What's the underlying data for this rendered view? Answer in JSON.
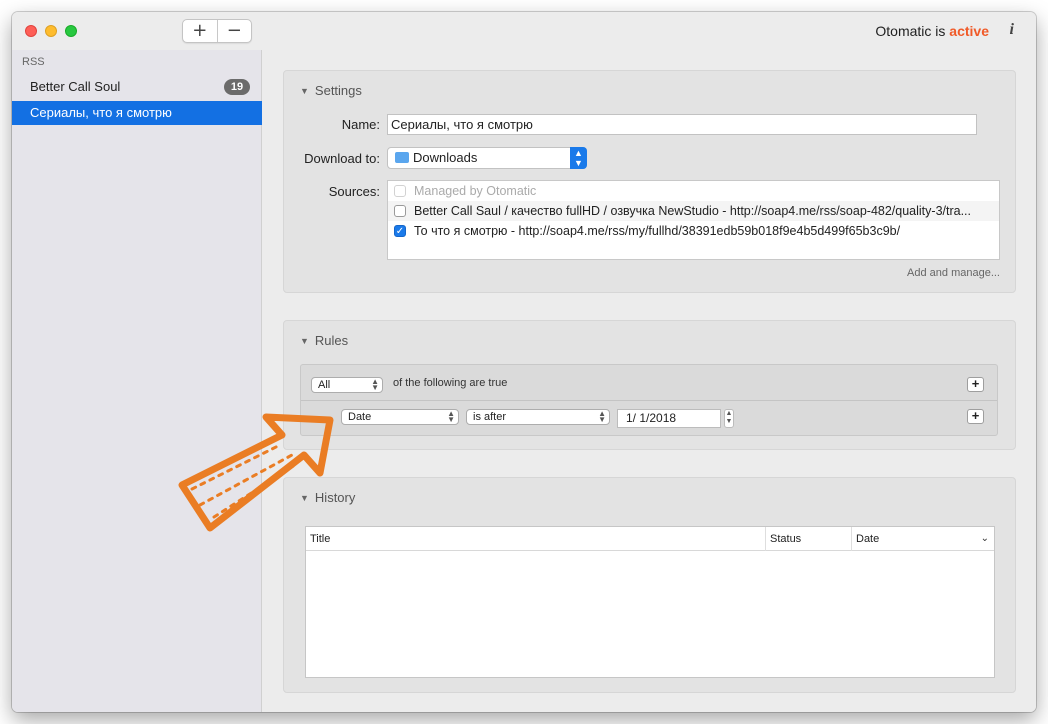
{
  "window": {
    "status_prefix": "Otomatic is",
    "status_value": "active",
    "info_icon": "i",
    "toolbar": {
      "add_label": "+",
      "remove_label": "−"
    }
  },
  "sidebar": {
    "header": "RSS",
    "items": [
      {
        "label": "Better Call Soul",
        "badge": "19"
      },
      {
        "label": "Сериалы, что я смотрю"
      }
    ]
  },
  "settings": {
    "title": "Settings",
    "name_label": "Name:",
    "name_value": "Сериалы, что я смотрю",
    "download_label": "Download to:",
    "download_value": "Downloads",
    "sources_label": "Sources:",
    "sources": [
      {
        "label": "Managed by Otomatic",
        "checked": false,
        "disabled": true
      },
      {
        "label": "Better Call Saul / качество fullHD / озвучка NewStudio - http://soap4.me/rss/soap-482/quality-3/tra...",
        "checked": false
      },
      {
        "label": "То что я смотрю - http://soap4.me/rss/my/fullhd/38391edb59b018f9e4b5d499f65b3c9b/",
        "checked": true
      }
    ],
    "add_manage": "Add and manage..."
  },
  "rules": {
    "title": "Rules",
    "match_value": "All",
    "match_suffix": "of the following are true",
    "field_value": "Date",
    "operator_value": "is after",
    "date_value": "1/  1/2018",
    "add_label": "+"
  },
  "history": {
    "title": "History",
    "columns": [
      "Title",
      "Status",
      "Date"
    ]
  },
  "colors": {
    "accent": "#1370e3",
    "active": "#f05a28",
    "arrow": "#ea7d24"
  }
}
